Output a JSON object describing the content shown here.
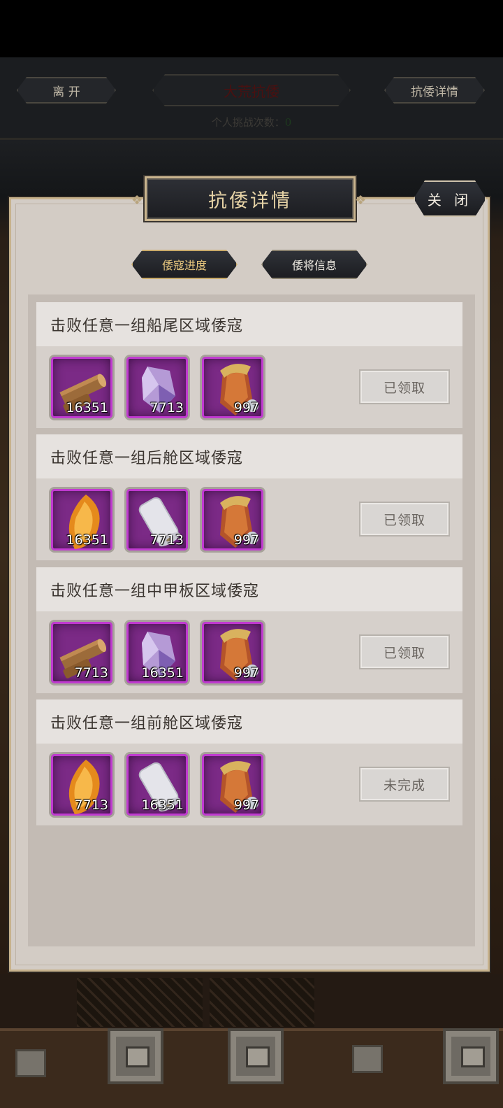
{
  "top_bar": {
    "leave_label": "离 开",
    "event_title": "大荒抗倭",
    "details_label": "抗倭详情",
    "challenge_label": "个人挑战次数：",
    "challenge_value": "0"
  },
  "dialog": {
    "title": "抗倭详情",
    "close_label": "关 闭",
    "tabs": [
      {
        "label": "倭寇进度",
        "active": true
      },
      {
        "label": "倭将信息",
        "active": false
      }
    ],
    "missions": [
      {
        "title": "击败任意一组船尾区域倭寇",
        "rewards": [
          {
            "icon": "wood-log-icon",
            "count": "16351"
          },
          {
            "icon": "amethyst-crystal-icon",
            "count": "7713"
          },
          {
            "icon": "bronze-gauntlet-icon",
            "count": "997"
          }
        ],
        "status": "已领取"
      },
      {
        "title": "击败任意一组后舱区域倭寇",
        "rewards": [
          {
            "icon": "amber-leaf-icon",
            "count": "16351"
          },
          {
            "icon": "silk-roll-icon",
            "count": "7713"
          },
          {
            "icon": "bronze-gauntlet-icon",
            "count": "997"
          }
        ],
        "status": "已领取"
      },
      {
        "title": "击败任意一组中甲板区域倭寇",
        "rewards": [
          {
            "icon": "wood-log-icon",
            "count": "7713"
          },
          {
            "icon": "amethyst-crystal-icon",
            "count": "16351"
          },
          {
            "icon": "bronze-gauntlet-icon",
            "count": "997"
          }
        ],
        "status": "已领取"
      },
      {
        "title": "击败任意一组前舱区域倭寇",
        "rewards": [
          {
            "icon": "amber-leaf-icon",
            "count": "7713"
          },
          {
            "icon": "silk-roll-icon",
            "count": "16351"
          },
          {
            "icon": "bronze-gauntlet-icon",
            "count": "997"
          }
        ],
        "status": "未完成"
      }
    ]
  },
  "colors": {
    "reward_frame": "#7b2a86",
    "title_gold": "#e6d3a6",
    "panel_bg": "#d3ccc5"
  }
}
